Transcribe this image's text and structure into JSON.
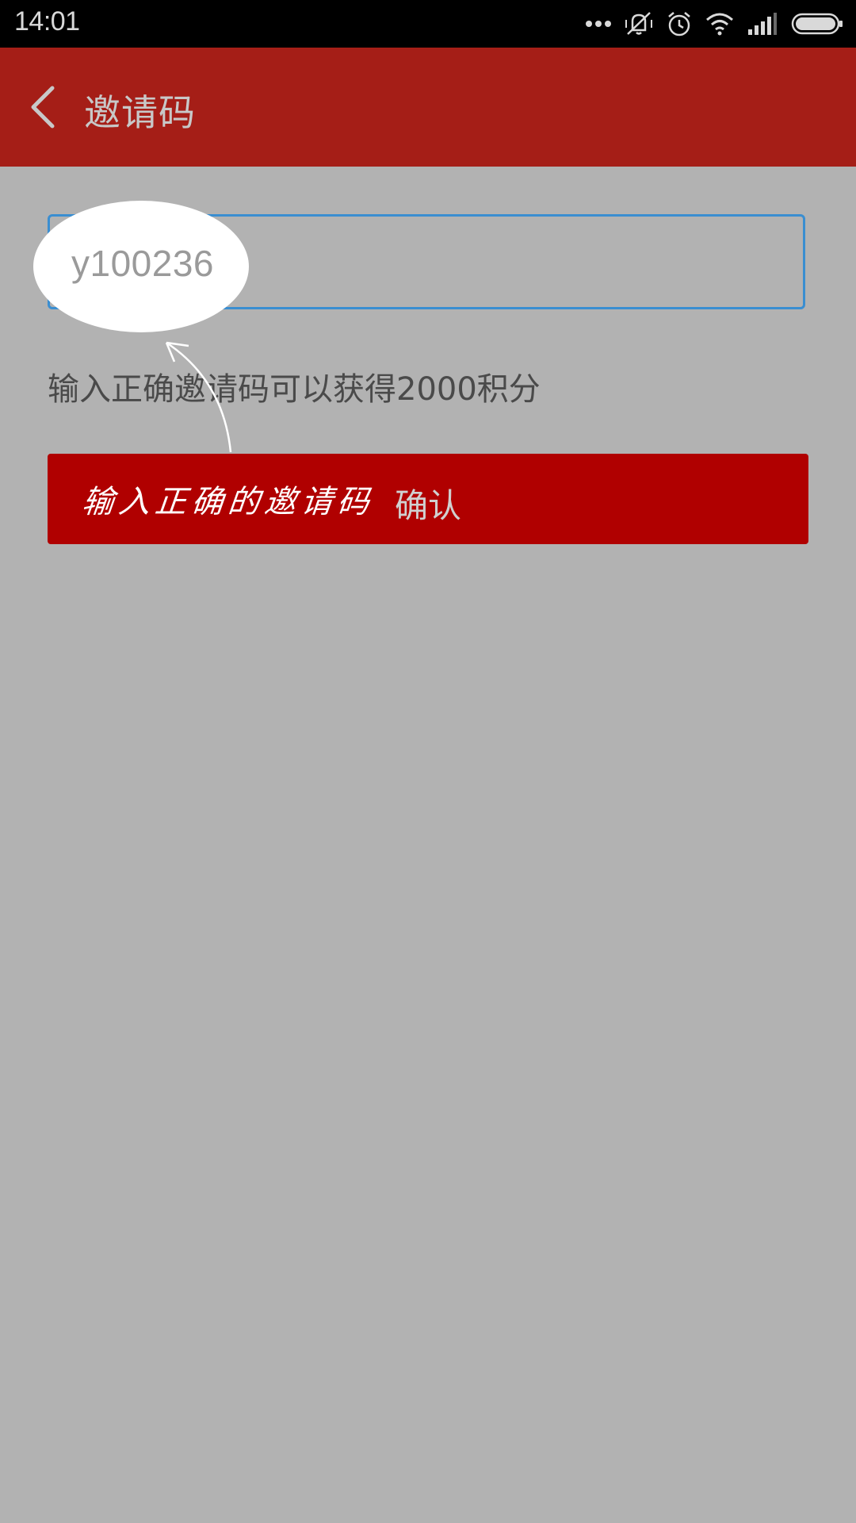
{
  "status_bar": {
    "time": "14:01",
    "icons": [
      "more-dots-icon",
      "vibrate-mute-icon",
      "alarm-icon",
      "wifi-icon",
      "signal-icon",
      "battery-icon"
    ]
  },
  "app_bar": {
    "back_icon": "chevron-left-icon",
    "title": "邀请码",
    "background_color": "#a51e17"
  },
  "form": {
    "invite_code_value": "y100236",
    "hint": "输入正确邀请码可以获得2000积分",
    "confirm_label": "确认",
    "button_color": "#b00000",
    "input_border_color": "#3a8ed1"
  },
  "annotation": {
    "handwritten_note": "输入正确的邀请码"
  }
}
